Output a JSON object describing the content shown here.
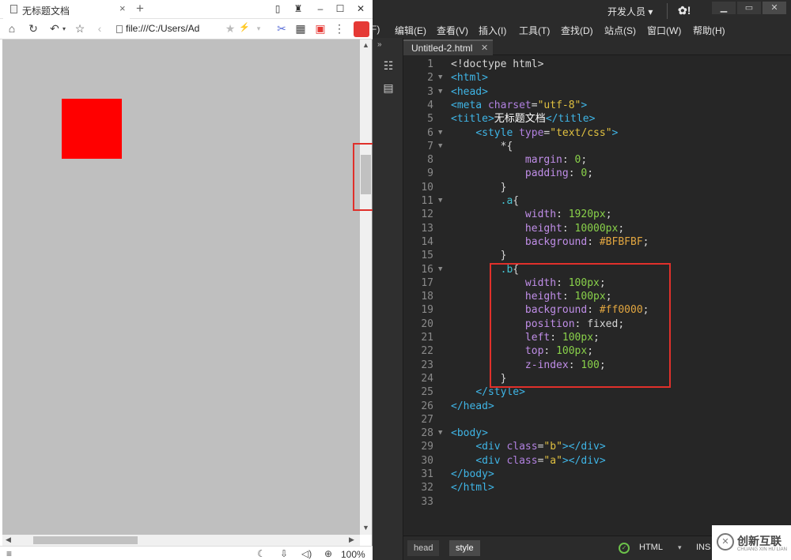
{
  "browser": {
    "tab_title": "无标题文档",
    "tab_close": "×",
    "new_tab": "+",
    "url": "file:///C:/Users/Ad",
    "zoom": "100%",
    "viewport_bg": "#BFBFBF",
    "red_box_color": "#ff0000",
    "icons": [
      "home-icon",
      "refresh-icon",
      "undo-icon",
      "star-icon",
      "back-icon",
      "cut-icon",
      "grid-icon",
      "pdf-icon",
      "more-icon"
    ]
  },
  "editor": {
    "user_role": "开发人员",
    "menu": [
      "F)",
      "编辑(E)",
      "查看(V)",
      "插入(I)",
      "工具(T)",
      "查找(D)",
      "站点(S)",
      "窗口(W)",
      "帮助(H)"
    ],
    "doc_tab": "Untitled-2.html",
    "status": {
      "crumbs": [
        "head",
        "style"
      ],
      "doc_type": "HTML",
      "mode": "INS"
    },
    "code": [
      {
        "n": "1",
        "fold": ""
      },
      {
        "n": "2",
        "fold": "▼"
      },
      {
        "n": "3",
        "fold": "▼"
      },
      {
        "n": "4",
        "fold": ""
      },
      {
        "n": "5",
        "fold": ""
      },
      {
        "n": "6",
        "fold": "▼"
      },
      {
        "n": "7",
        "fold": "▼"
      },
      {
        "n": "8",
        "fold": ""
      },
      {
        "n": "9",
        "fold": ""
      },
      {
        "n": "10",
        "fold": ""
      },
      {
        "n": "11",
        "fold": "▼"
      },
      {
        "n": "12",
        "fold": ""
      },
      {
        "n": "13",
        "fold": ""
      },
      {
        "n": "14",
        "fold": ""
      },
      {
        "n": "15",
        "fold": ""
      },
      {
        "n": "16",
        "fold": "▼"
      },
      {
        "n": "17",
        "fold": ""
      },
      {
        "n": "18",
        "fold": ""
      },
      {
        "n": "19",
        "fold": ""
      },
      {
        "n": "20",
        "fold": ""
      },
      {
        "n": "21",
        "fold": ""
      },
      {
        "n": "22",
        "fold": ""
      },
      {
        "n": "23",
        "fold": ""
      },
      {
        "n": "24",
        "fold": ""
      },
      {
        "n": "25",
        "fold": ""
      },
      {
        "n": "26",
        "fold": ""
      },
      {
        "n": "27",
        "fold": ""
      },
      {
        "n": "28",
        "fold": "▼"
      },
      {
        "n": "29",
        "fold": ""
      },
      {
        "n": "30",
        "fold": ""
      },
      {
        "n": "31",
        "fold": ""
      },
      {
        "n": "32",
        "fold": ""
      },
      {
        "n": "33",
        "fold": ""
      }
    ],
    "code_tokens": [
      [
        [
          "pun",
          "<!doctype html>"
        ]
      ],
      [
        [
          "tag",
          "<html>"
        ]
      ],
      [
        [
          "tag",
          "<head>"
        ]
      ],
      [
        [
          "tag",
          "<meta "
        ],
        [
          "attr",
          "charset"
        ],
        [
          "pun",
          "="
        ],
        [
          "str",
          "\"utf-8\""
        ],
        [
          "tag",
          ">"
        ]
      ],
      [
        [
          "tag",
          "<title>"
        ],
        [
          "txt",
          "无标题文档"
        ],
        [
          "tag",
          "</title>"
        ]
      ],
      [
        [
          "pun",
          "    "
        ],
        [
          "tag",
          "<style "
        ],
        [
          "attr",
          "type"
        ],
        [
          "pun",
          "="
        ],
        [
          "str",
          "\"text/css\""
        ],
        [
          "tag",
          ">"
        ]
      ],
      [
        [
          "pun",
          "        *{"
        ]
      ],
      [
        [
          "pun",
          "            "
        ],
        [
          "prop",
          "margin"
        ],
        [
          "pun",
          ": "
        ],
        [
          "num",
          "0"
        ],
        [
          "pun",
          ";"
        ]
      ],
      [
        [
          "pun",
          "            "
        ],
        [
          "prop",
          "padding"
        ],
        [
          "pun",
          ": "
        ],
        [
          "num",
          "0"
        ],
        [
          "pun",
          ";"
        ]
      ],
      [
        [
          "pun",
          "        }"
        ]
      ],
      [
        [
          "pun",
          "        "
        ],
        [
          "sel",
          ".a"
        ],
        [
          "pun",
          "{"
        ]
      ],
      [
        [
          "pun",
          "            "
        ],
        [
          "prop",
          "width"
        ],
        [
          "pun",
          ": "
        ],
        [
          "num",
          "1920px"
        ],
        [
          "pun",
          ";"
        ]
      ],
      [
        [
          "pun",
          "            "
        ],
        [
          "prop",
          "height"
        ],
        [
          "pun",
          ": "
        ],
        [
          "num",
          "10000px"
        ],
        [
          "pun",
          ";"
        ]
      ],
      [
        [
          "pun",
          "            "
        ],
        [
          "prop",
          "background"
        ],
        [
          "pun",
          ": "
        ],
        [
          "hex",
          "#BFBFBF"
        ],
        [
          "pun",
          ";"
        ]
      ],
      [
        [
          "pun",
          "        }"
        ]
      ],
      [
        [
          "pun",
          "        "
        ],
        [
          "sel",
          ".b"
        ],
        [
          "pun",
          "{"
        ]
      ],
      [
        [
          "pun",
          "            "
        ],
        [
          "prop",
          "width"
        ],
        [
          "pun",
          ": "
        ],
        [
          "num",
          "100px"
        ],
        [
          "pun",
          ";"
        ]
      ],
      [
        [
          "pun",
          "            "
        ],
        [
          "prop",
          "height"
        ],
        [
          "pun",
          ": "
        ],
        [
          "num",
          "100px"
        ],
        [
          "pun",
          ";"
        ]
      ],
      [
        [
          "pun",
          "            "
        ],
        [
          "prop",
          "background"
        ],
        [
          "pun",
          ": "
        ],
        [
          "hex",
          "#ff0000"
        ],
        [
          "pun",
          ";"
        ]
      ],
      [
        [
          "pun",
          "            "
        ],
        [
          "prop",
          "position"
        ],
        [
          "pun",
          ": fixed;"
        ]
      ],
      [
        [
          "pun",
          "            "
        ],
        [
          "prop",
          "left"
        ],
        [
          "pun",
          ": "
        ],
        [
          "num",
          "100px"
        ],
        [
          "pun",
          ";"
        ]
      ],
      [
        [
          "pun",
          "            "
        ],
        [
          "prop",
          "top"
        ],
        [
          "pun",
          ": "
        ],
        [
          "num",
          "100px"
        ],
        [
          "pun",
          ";"
        ]
      ],
      [
        [
          "pun",
          "            "
        ],
        [
          "prop",
          "z-index"
        ],
        [
          "pun",
          ": "
        ],
        [
          "num",
          "100"
        ],
        [
          "pun",
          ";"
        ]
      ],
      [
        [
          "pun",
          "        }"
        ]
      ],
      [
        [
          "pun",
          "    "
        ],
        [
          "tag",
          "</style>"
        ]
      ],
      [
        [
          "tag",
          "</head>"
        ]
      ],
      [],
      [
        [
          "tag",
          "<body>"
        ]
      ],
      [
        [
          "pun",
          "    "
        ],
        [
          "tag",
          "<div "
        ],
        [
          "attr",
          "class"
        ],
        [
          "pun",
          "="
        ],
        [
          "str",
          "\"b\""
        ],
        [
          "tag",
          "></div>"
        ]
      ],
      [
        [
          "pun",
          "    "
        ],
        [
          "tag",
          "<div "
        ],
        [
          "attr",
          "class"
        ],
        [
          "pun",
          "="
        ],
        [
          "str",
          "\"a\""
        ],
        [
          "tag",
          "></div>"
        ]
      ],
      [
        [
          "tag",
          "</body>"
        ]
      ],
      [
        [
          "tag",
          "</html>"
        ]
      ],
      []
    ]
  },
  "watermark": {
    "brand": "创新互联",
    "sub": "CHUANG XIN HU LIAN",
    "logo_glyph": "✕"
  }
}
